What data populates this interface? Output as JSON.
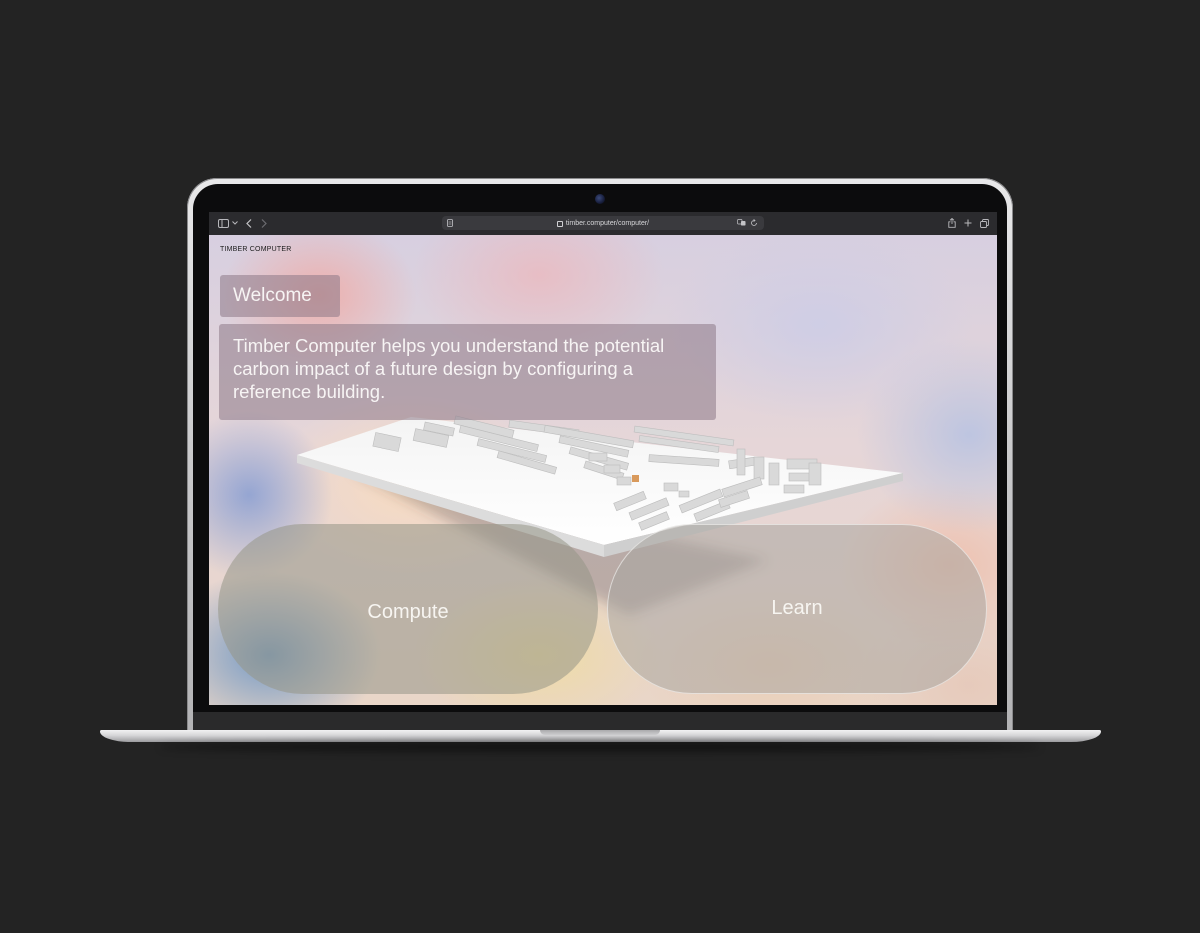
{
  "browser": {
    "url": "timber.computer/computer/"
  },
  "site": {
    "brand": "TIMBER COMPUTER"
  },
  "main": {
    "welcome_heading": "Welcome",
    "intro_text": "Timber Computer helps you understand the potential carbon impact of a future design by configuring a reference building.",
    "compute_label": "Compute",
    "learn_label": "Learn"
  },
  "colors": {
    "background": "#232323",
    "panel": "#8c7887",
    "highlight_building": "#d99a5c"
  },
  "icons": {
    "sidebar": "sidebar-icon",
    "back": "chevron-left-icon",
    "forward": "chevron-right-icon",
    "reader": "reader-icon",
    "lock": "lock-icon",
    "translate": "translate-icon",
    "reload": "reload-icon",
    "share": "share-icon",
    "new_tab": "plus-icon",
    "tabs": "tabs-icon"
  }
}
